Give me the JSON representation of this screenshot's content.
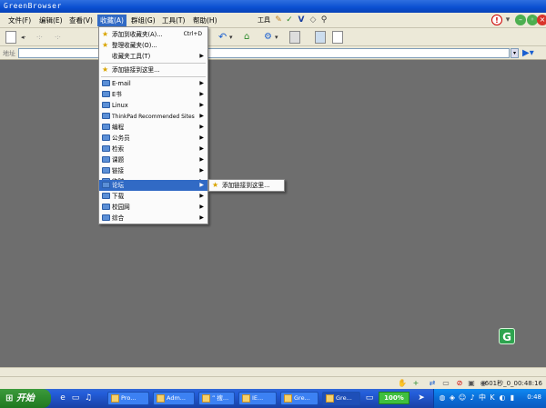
{
  "window": {
    "title": "GreenBrowser"
  },
  "menubar": {
    "items": [
      {
        "label": "文件(F)"
      },
      {
        "label": "编辑(E)"
      },
      {
        "label": "查看(V)"
      },
      {
        "label": "收藏(A)"
      },
      {
        "label": "群组(G)"
      },
      {
        "label": "工具(T)"
      },
      {
        "label": "帮助(H)"
      }
    ],
    "tools_label": "工具",
    "tool_icons": [
      "feather-icon",
      "check-icon",
      "v-icon",
      "diamond-icon",
      "magnifier-icon"
    ]
  },
  "toolbar": {
    "buttons": [
      "new-page-icon",
      "back-icon",
      "forward-icon",
      "refresh-icon",
      "undo-icon",
      "home-icon",
      "settings-icon",
      "save-icon",
      "screen-icon",
      "notes-icon"
    ]
  },
  "address": {
    "label": "地址",
    "value": "",
    "go_icon": "go-arrow-icon"
  },
  "favorites_menu": {
    "top_items": [
      {
        "label": "添加到收藏夹(A)...",
        "shortcut": "Ctrl+D",
        "icon": "star-add-icon"
      },
      {
        "label": "整理收藏夹(O)...",
        "icon": "star-organize-icon"
      },
      {
        "label": "收藏夹工具(T)",
        "arrow": "▶",
        "icon": ""
      }
    ],
    "add_link": {
      "label": "添加链接到这里...",
      "icon": "star-add-icon"
    },
    "folders": [
      {
        "label": "E-mail"
      },
      {
        "label": "E书"
      },
      {
        "label": "Linux"
      },
      {
        "label": "ThinkPad Recommended Sites"
      },
      {
        "label": "编程"
      },
      {
        "label": "公务员"
      },
      {
        "label": "检索"
      },
      {
        "label": "课题"
      },
      {
        "label": "链接"
      },
      {
        "label": "临时"
      },
      {
        "label": "论坛"
      },
      {
        "label": "下载"
      },
      {
        "label": "校园网"
      },
      {
        "label": "综合"
      }
    ],
    "arrow": "▶"
  },
  "submenu": {
    "label": "添加链接到这里..."
  },
  "statusbar": {
    "time": "601秒_0_00:48:16"
  },
  "taskbar": {
    "start_label": "开始",
    "tasks": [
      {
        "label": "Pro..."
      },
      {
        "label": "Adm..."
      },
      {
        "label": "” 搜..."
      },
      {
        "label": "IE..."
      },
      {
        "label": "Gre..."
      },
      {
        "label": "Gre..."
      }
    ],
    "zoom": "100%",
    "clock": "0:48"
  },
  "colors": {
    "selection": "#316ac5",
    "taskbar": "#245edb",
    "start": "#2d8a2d"
  }
}
